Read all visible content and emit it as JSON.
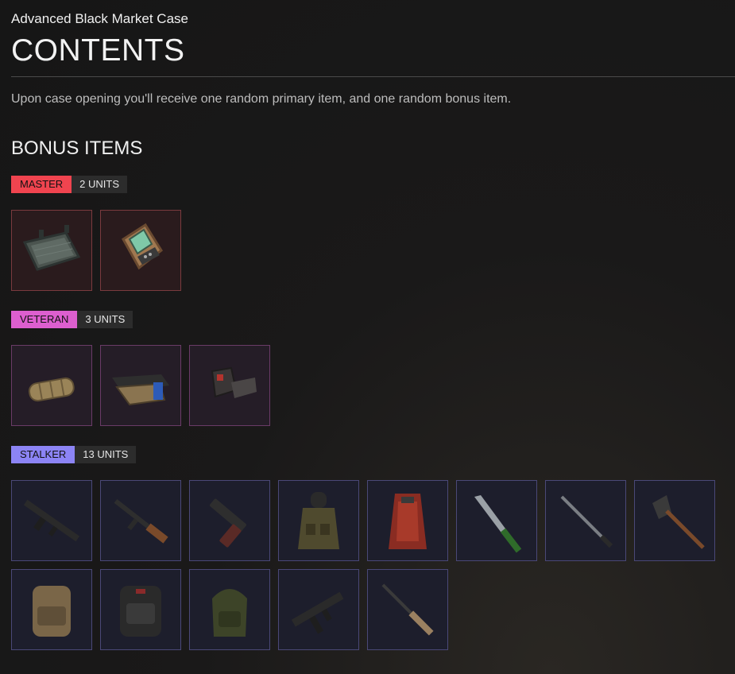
{
  "case_name": "Advanced Black Market Case",
  "title": "CONTENTS",
  "description": "Upon case opening you'll receive one random primary item, and one random bonus item.",
  "section_title": "BONUS ITEMS",
  "tiers": [
    {
      "key": "master",
      "label": "MASTER",
      "units": "2 UNITS",
      "color": "#f0444f",
      "items": [
        "armor-plate-icon",
        "detector-device-icon"
      ]
    },
    {
      "key": "veteran",
      "label": "VETERAN",
      "units": "3 UNITS",
      "color": "#dd5fcf",
      "items": [
        "suppressor-icon",
        "foregrip-icon",
        "red-dot-sight-icon"
      ]
    },
    {
      "key": "stalker",
      "label": "STALKER",
      "units": "13 UNITS",
      "color": "#8c84f5",
      "items": [
        "assault-rifle-icon",
        "ak-rifle-icon",
        "pistol-icon",
        "tactical-vest-icon",
        "red-armor-vest-icon",
        "combat-knife-icon",
        "bayonet-icon",
        "shovel-icon",
        "tan-backpack-icon",
        "black-backpack-icon",
        "green-backpack-icon",
        "submachine-gun-icon",
        "sniper-rifle-icon"
      ]
    }
  ]
}
